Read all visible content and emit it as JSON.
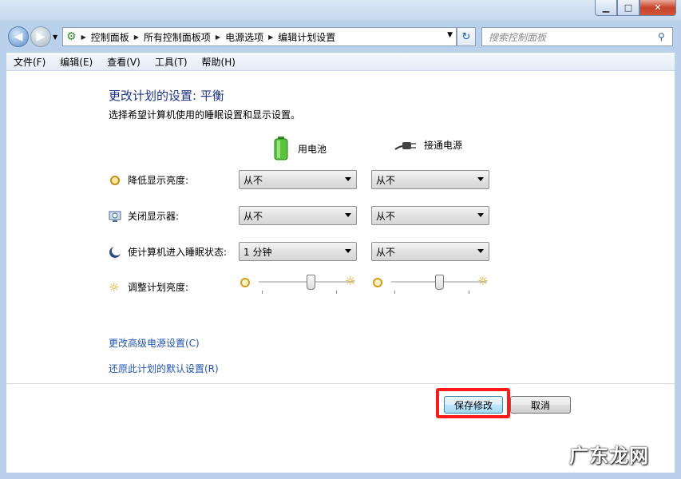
{
  "window": {
    "min_label": "▁",
    "max_label": "□",
    "close_label": "✕"
  },
  "address": {
    "crumbs": [
      "控制面板",
      "所有控制面板项",
      "电源选项",
      "编辑计划设置"
    ]
  },
  "search": {
    "placeholder": "搜索控制面板"
  },
  "menus": [
    "文件(F)",
    "编辑(E)",
    "查看(V)",
    "工具(T)",
    "帮助(H)"
  ],
  "page": {
    "title": "更改计划的设置: 平衡",
    "subtitle": "选择希望计算机使用的睡眠设置和显示设置。",
    "col_battery": "用电池",
    "col_plugged": "接通电源"
  },
  "settings": [
    {
      "label": "降低显示亮度:",
      "battery": "从不",
      "plugged": "从不",
      "icon": "dim-icon"
    },
    {
      "label": "关闭显示器:",
      "battery": "从不",
      "plugged": "从不",
      "icon": "monitor-icon"
    },
    {
      "label": "使计算机进入睡眠状态:",
      "battery": "1 分钟",
      "plugged": "从不",
      "icon": "sleep-icon"
    }
  ],
  "brightness": {
    "label": "调整计划亮度:",
    "battery_level": 0.55,
    "plugged_level": 0.5
  },
  "links": {
    "advanced": "更改高级电源设置(C)",
    "restore": "还原此计划的默认设置(R)"
  },
  "buttons": {
    "save": "保存修改",
    "cancel": "取消"
  },
  "watermark": "广东龙网",
  "colors": {
    "title": "#1e3287",
    "link": "#1f55b5",
    "highlight": "#ff1a1a"
  }
}
